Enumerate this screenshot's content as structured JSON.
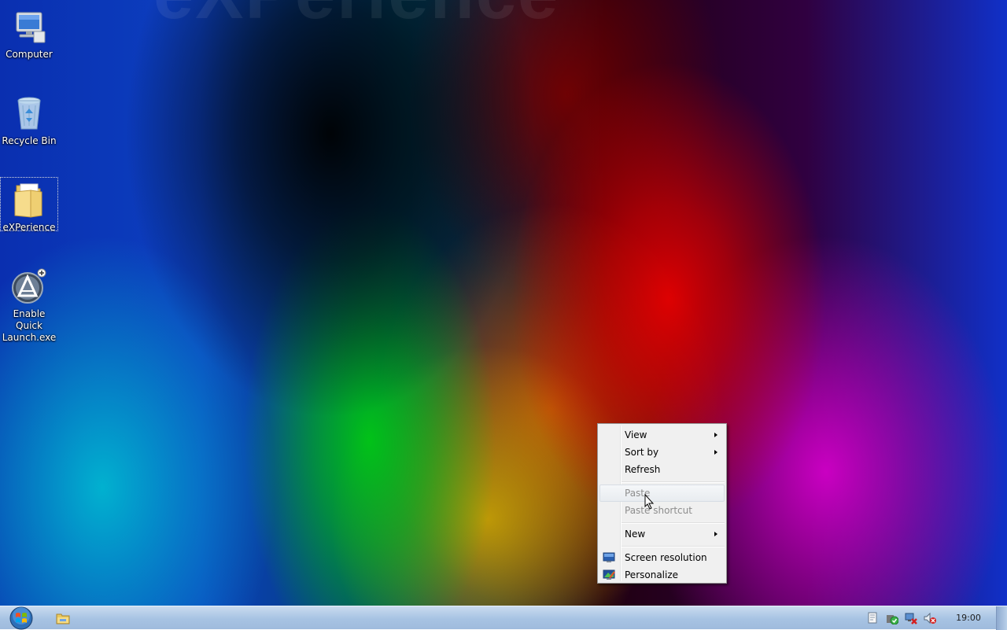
{
  "desktop": {
    "watermark": "eXPerience",
    "icons": [
      {
        "label": "Computer",
        "icon": "computer-icon"
      },
      {
        "label": "Recycle Bin",
        "icon": "recycle-bin-icon"
      },
      {
        "label": "eXPerience",
        "icon": "folder-icon",
        "selected": true
      },
      {
        "label_line1": "Enable Quick",
        "label_line2": "Launch.exe",
        "icon": "executable-icon"
      }
    ]
  },
  "context_menu": {
    "items": [
      {
        "label": "View",
        "submenu": true,
        "enabled": true
      },
      {
        "label": "Sort by",
        "submenu": true,
        "enabled": true
      },
      {
        "label": "Refresh",
        "submenu": false,
        "enabled": true
      },
      {
        "label": "Paste",
        "submenu": false,
        "enabled": false,
        "hovered": true
      },
      {
        "label": "Paste shortcut",
        "submenu": false,
        "enabled": false
      },
      {
        "label": "New",
        "submenu": true,
        "enabled": true
      },
      {
        "label": "Screen resolution",
        "submenu": false,
        "enabled": true,
        "icon": "display-settings-icon"
      },
      {
        "label": "Personalize",
        "submenu": false,
        "enabled": true,
        "icon": "personalize-icon"
      }
    ]
  },
  "taskbar": {
    "start_icon": "windows-orb-icon",
    "pinned": [
      {
        "icon": "windows-explorer-icon"
      }
    ],
    "tray": [
      {
        "icon": "action-center-icon"
      },
      {
        "icon": "security-shield-icon"
      },
      {
        "icon": "network-icon"
      },
      {
        "icon": "volume-muted-icon"
      }
    ],
    "clock": "19:00"
  },
  "colors": {
    "menu_bg": "#f0f0f0",
    "menu_disabled_text": "#8d8d8d",
    "taskbar_top": "#c9dbef",
    "taskbar_bottom": "#9fbbdd"
  }
}
